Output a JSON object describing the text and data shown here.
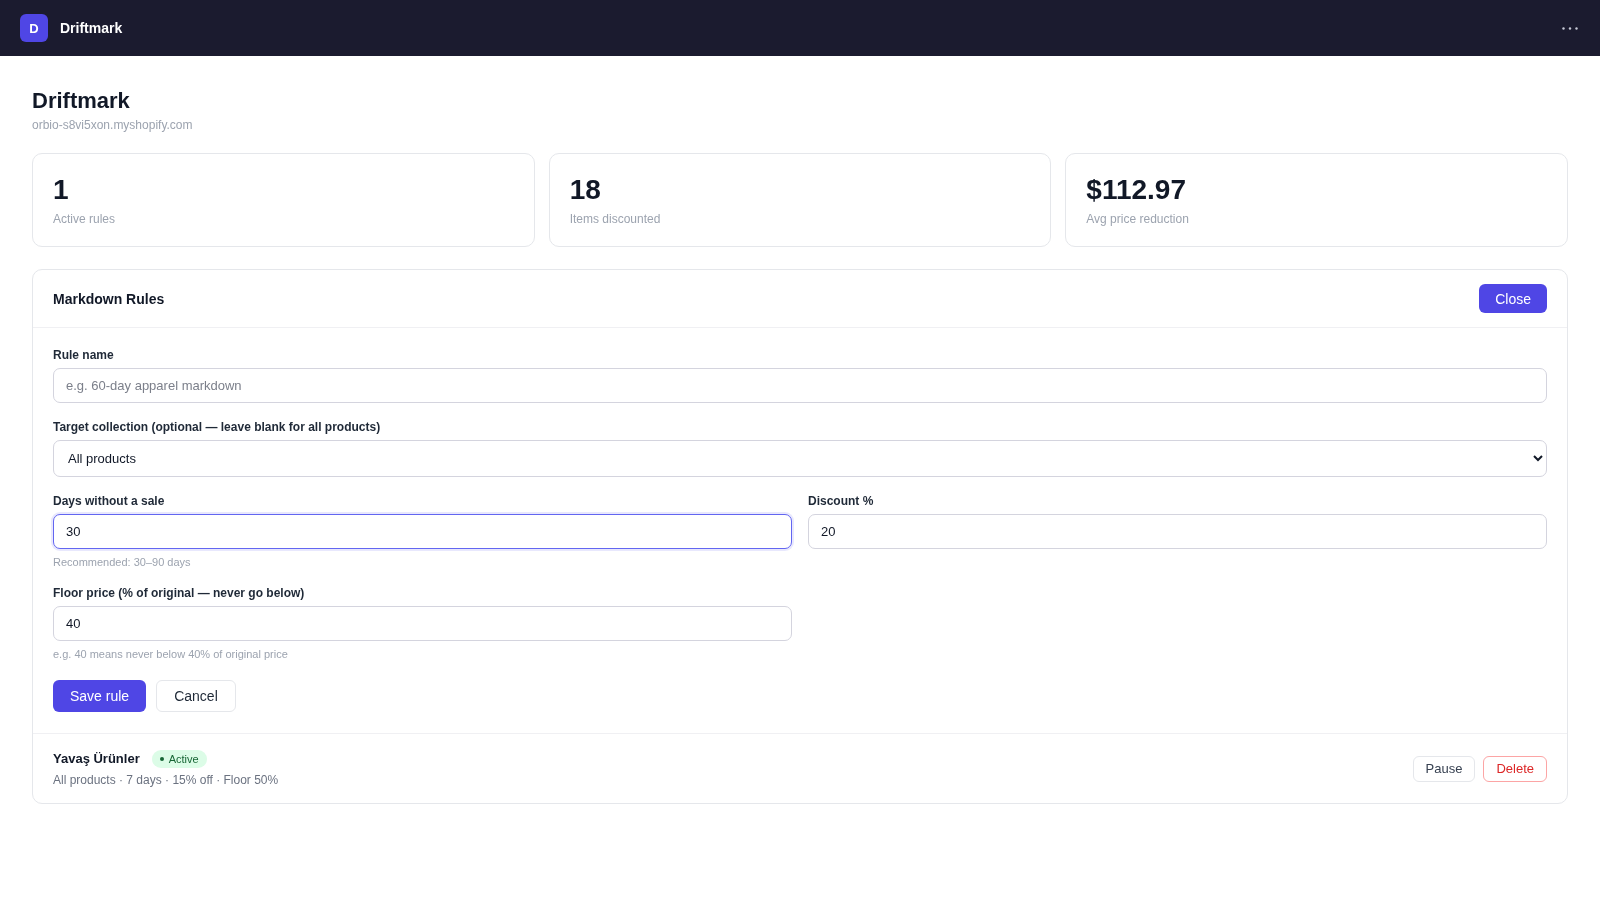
{
  "top_bar": {
    "logo_letter": "D",
    "app_name": "Driftmark"
  },
  "page_header": {
    "title": "Driftmark",
    "domain": "orbio-s8vi5xon.myshopify.com"
  },
  "stats": [
    {
      "value": "1",
      "label": "Active rules"
    },
    {
      "value": "18",
      "label": "Items discounted"
    },
    {
      "value": "$112.97",
      "label": "Avg price reduction"
    }
  ],
  "rules_panel": {
    "title": "Markdown Rules",
    "close_button": "Close",
    "form": {
      "fields": [
        {
          "kind": "text",
          "label": "Rule name",
          "placeholder": "e.g. 60-day apparel markdown",
          "focused": false
        },
        {
          "kind": "select",
          "label": "Target collection (optional — leave blank for all products)",
          "value": "All products"
        },
        {
          "kind": "number",
          "label": "Days without a sale",
          "value": "30",
          "focused": true,
          "hint": "Recommended: 30–90 days"
        },
        {
          "kind": "number",
          "label": "Discount %",
          "value": "20",
          "focused": false
        },
        {
          "kind": "number",
          "label": "Floor price (% of original — never go below)",
          "value": "40",
          "focused": false,
          "hint": "e.g. 40 means never below 40% of original price"
        }
      ],
      "buttons": [
        {
          "label": "Save rule",
          "kind": "primary"
        },
        {
          "label": "Cancel",
          "kind": "secondary"
        }
      ]
    },
    "rules": [
      {
        "name": "Yavaş Ürünler",
        "status": {
          "label": "Active",
          "active": true
        },
        "summary": "All products · 7 days · 15% off · Floor 50%",
        "actions": [
          {
            "label": "Pause",
            "kind": "neutral"
          },
          {
            "label": "Delete",
            "kind": "danger"
          }
        ]
      }
    ]
  }
}
